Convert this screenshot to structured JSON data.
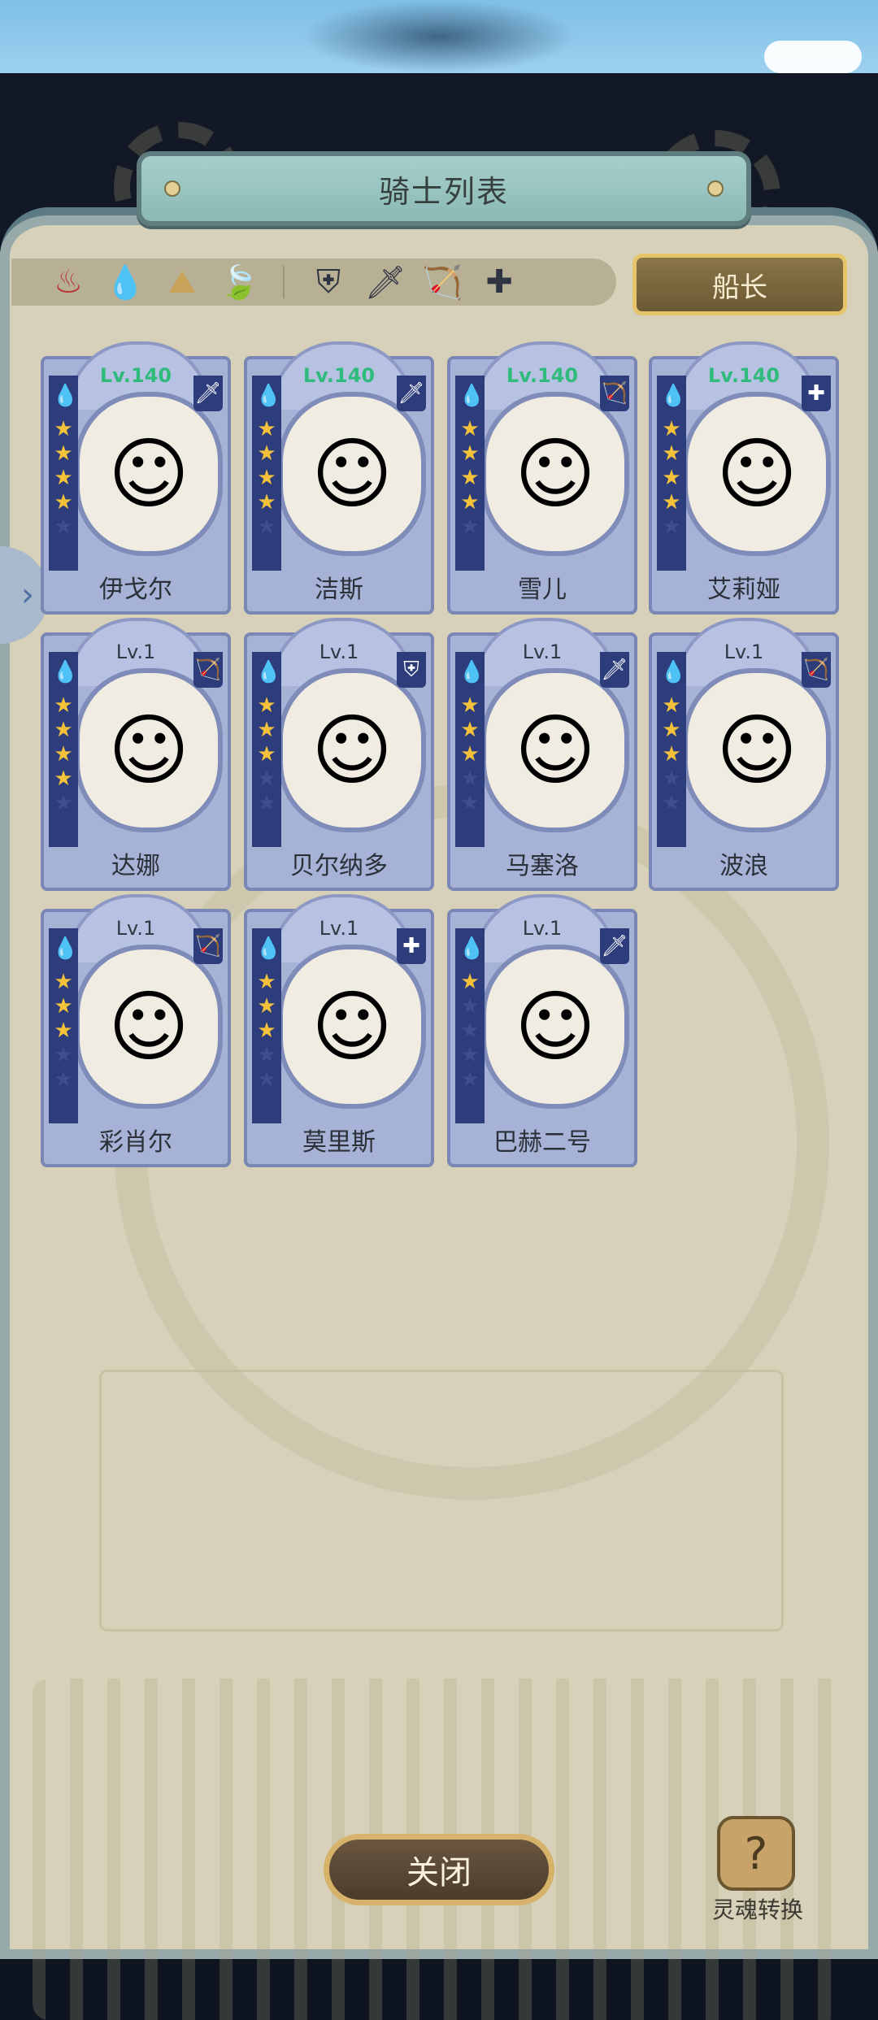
{
  "header": {
    "title": "骑士列表"
  },
  "filters": {
    "elements": [
      "fire-icon",
      "water-icon",
      "earth-icon",
      "wind-icon"
    ],
    "roles": [
      "shield-icon",
      "sword-icon",
      "bow-icon",
      "cross-icon"
    ],
    "captain_label": "船长"
  },
  "knights": [
    {
      "name": "伊戈尔",
      "level": "Lv.140",
      "stars": 4,
      "role": "sword"
    },
    {
      "name": "洁斯",
      "level": "Lv.140",
      "stars": 4,
      "role": "sword"
    },
    {
      "name": "雪儿",
      "level": "Lv.140",
      "stars": 4,
      "role": "bow"
    },
    {
      "name": "艾莉娅",
      "level": "Lv.140",
      "stars": 4,
      "role": "cross"
    },
    {
      "name": "达娜",
      "level": "Lv.1",
      "stars": 4,
      "role": "bow"
    },
    {
      "name": "贝尔纳多",
      "level": "Lv.1",
      "stars": 3,
      "role": "shield"
    },
    {
      "name": "马塞洛",
      "level": "Lv.1",
      "stars": 3,
      "role": "sword"
    },
    {
      "name": "波浪",
      "level": "Lv.1",
      "stars": 3,
      "role": "bow"
    },
    {
      "name": "彩肖尔",
      "level": "Lv.1",
      "stars": 3,
      "role": "bow"
    },
    {
      "name": "莫里斯",
      "level": "Lv.1",
      "stars": 3,
      "role": "cross"
    },
    {
      "name": "巴赫二号",
      "level": "Lv.1",
      "stars": 1,
      "role": "sword"
    }
  ],
  "footer": {
    "close_label": "关闭",
    "soul_label": "灵魂转换"
  },
  "colors": {
    "level_high": "#2fbb7c",
    "star_on": "#f3c23a",
    "panel_bg": "#d6d1b8",
    "card_bg": "#a6b2d6"
  }
}
